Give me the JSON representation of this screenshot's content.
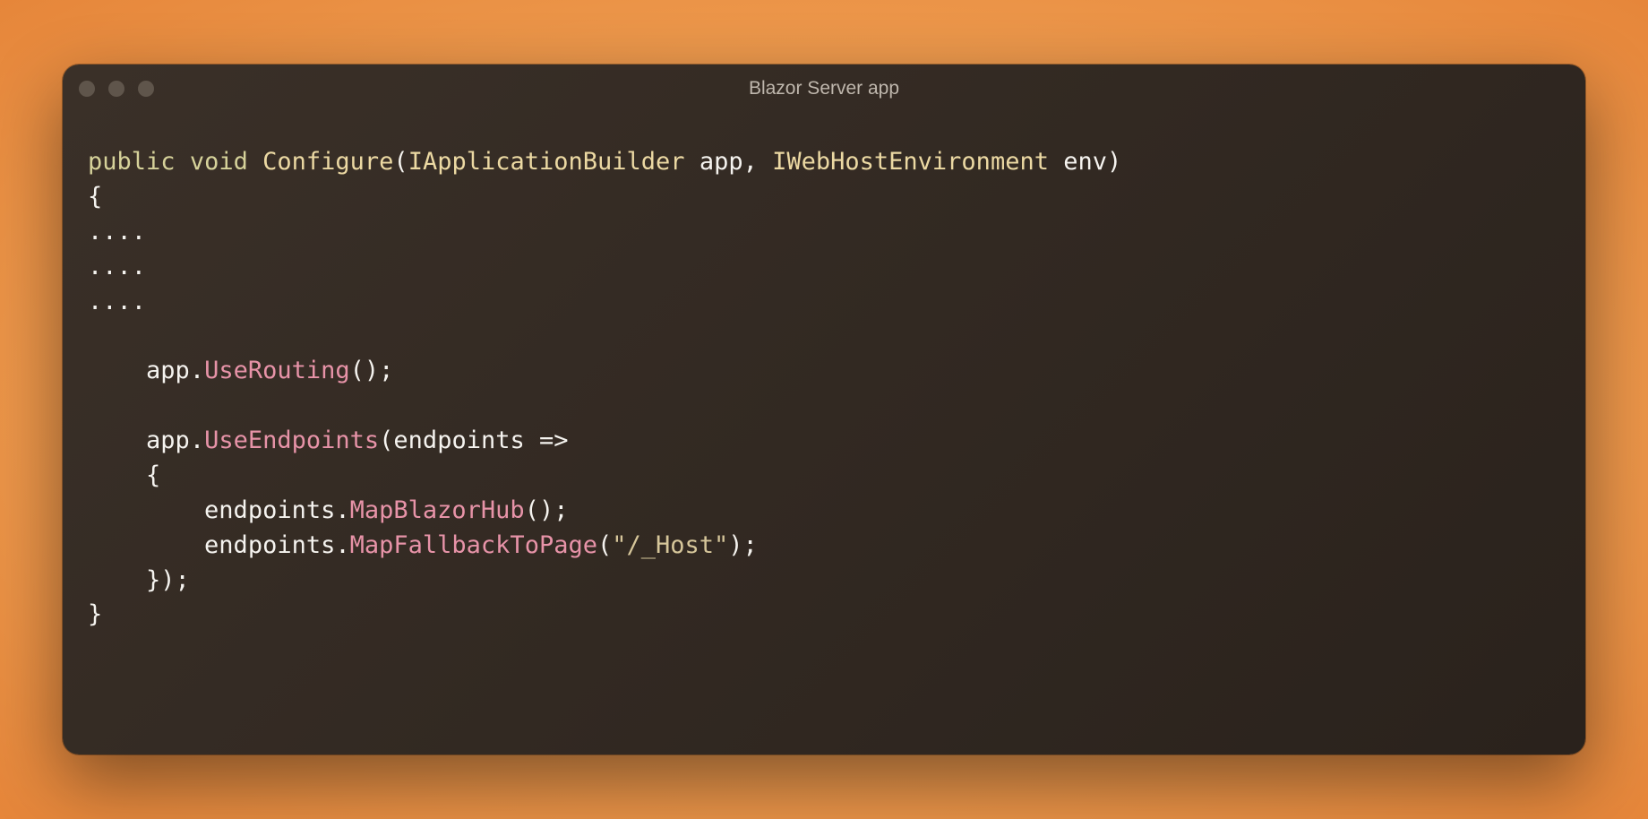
{
  "window": {
    "title": "Blazor Server app"
  },
  "code": {
    "l1_keyword_public": "public",
    "l1_space1": " ",
    "l1_keyword_void": "void",
    "l1_space2": " ",
    "l1_method_configure": "Configure",
    "l1_paren_open": "(",
    "l1_type_iappbuilder": "IApplicationBuilder",
    "l1_space3": " ",
    "l1_param_app": "app",
    "l1_comma": ", ",
    "l1_type_iwebhostenv": "IWebHostEnvironment",
    "l1_space4": " ",
    "l1_param_env": "env",
    "l1_paren_close": ")",
    "l2_brace_open": "{",
    "l3_dots": "....",
    "l4_dots": "....",
    "l5_dots": "....",
    "l7_indent": "    ",
    "l7_app": "app",
    "l7_dot": ".",
    "l7_method_userouting": "UseRouting",
    "l7_call": "();",
    "l9_indent": "    ",
    "l9_app": "app",
    "l9_dot": ".",
    "l9_method_useendpoints": "UseEndpoints",
    "l9_paren_open": "(",
    "l9_param_endpoints": "endpoints",
    "l9_arrow": " =>",
    "l10_indent": "    ",
    "l10_brace_open": "{",
    "l11_indent": "        ",
    "l11_endpoints": "endpoints",
    "l11_dot": ".",
    "l11_method_mapblazor": "MapBlazorHub",
    "l11_call": "();",
    "l12_indent": "        ",
    "l12_endpoints": "endpoints",
    "l12_dot": ".",
    "l12_method_mapfallback": "MapFallbackToPage",
    "l12_paren_open": "(",
    "l12_string_host": "\"/_Host\"",
    "l12_close": ");",
    "l13_indent": "    ",
    "l13_brace_close": "});",
    "l14_brace_close": "}"
  }
}
